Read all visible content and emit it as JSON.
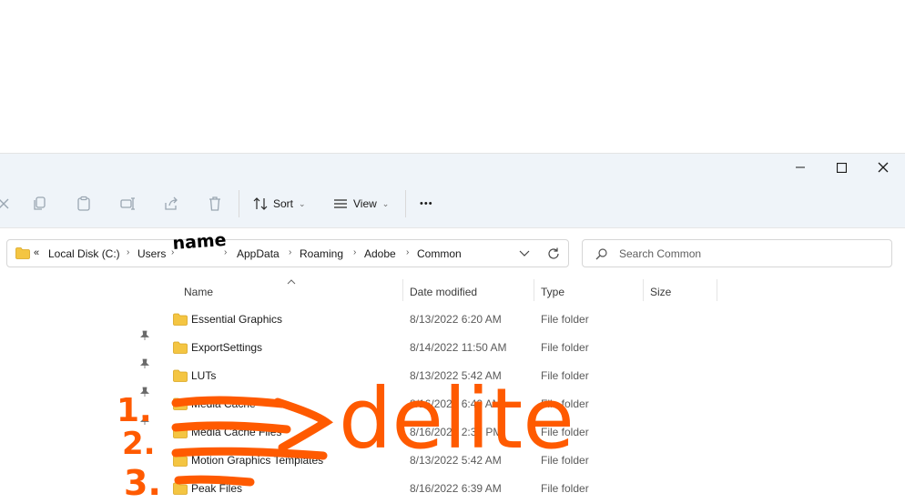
{
  "toolbar": {
    "sort_label": "Sort",
    "view_label": "View",
    "more_label": "•••"
  },
  "breadcrumb": {
    "overflow": "«",
    "items": [
      "Local Disk (C:)",
      "Users",
      "",
      "AppData",
      "Roaming",
      "Adobe",
      "Common"
    ]
  },
  "search": {
    "placeholder": "Search Common"
  },
  "columns": {
    "name": "Name",
    "date": "Date modified",
    "type": "Type",
    "size": "Size"
  },
  "files": [
    {
      "name": "Essential Graphics",
      "date": "8/13/2022 6:20 AM",
      "type": "File folder"
    },
    {
      "name": "ExportSettings",
      "date": "8/14/2022 11:50 AM",
      "type": "File folder"
    },
    {
      "name": "LUTs",
      "date": "8/13/2022 5:42 AM",
      "type": "File folder"
    },
    {
      "name": "Media Cache",
      "date": "8/16/2022 6:40 AM",
      "type": "File folder"
    },
    {
      "name": "Media Cache Files",
      "date": "8/16/2022 2:37 PM",
      "type": "File folder"
    },
    {
      "name": "Motion Graphics Templates",
      "date": "8/13/2022 5:42 AM",
      "type": "File folder"
    },
    {
      "name": "Peak Files",
      "date": "8/16/2022 6:39 AM",
      "type": "File folder"
    }
  ],
  "annotations": {
    "username_redaction": "name",
    "instruction": "delite",
    "step_1": "1.",
    "step_2": "2.",
    "step_3": "3."
  },
  "colors": {
    "titlebar_bg": "#eff4f9",
    "folder_yellow": "#f4c542",
    "annotation_orange": "#ff5a00"
  }
}
